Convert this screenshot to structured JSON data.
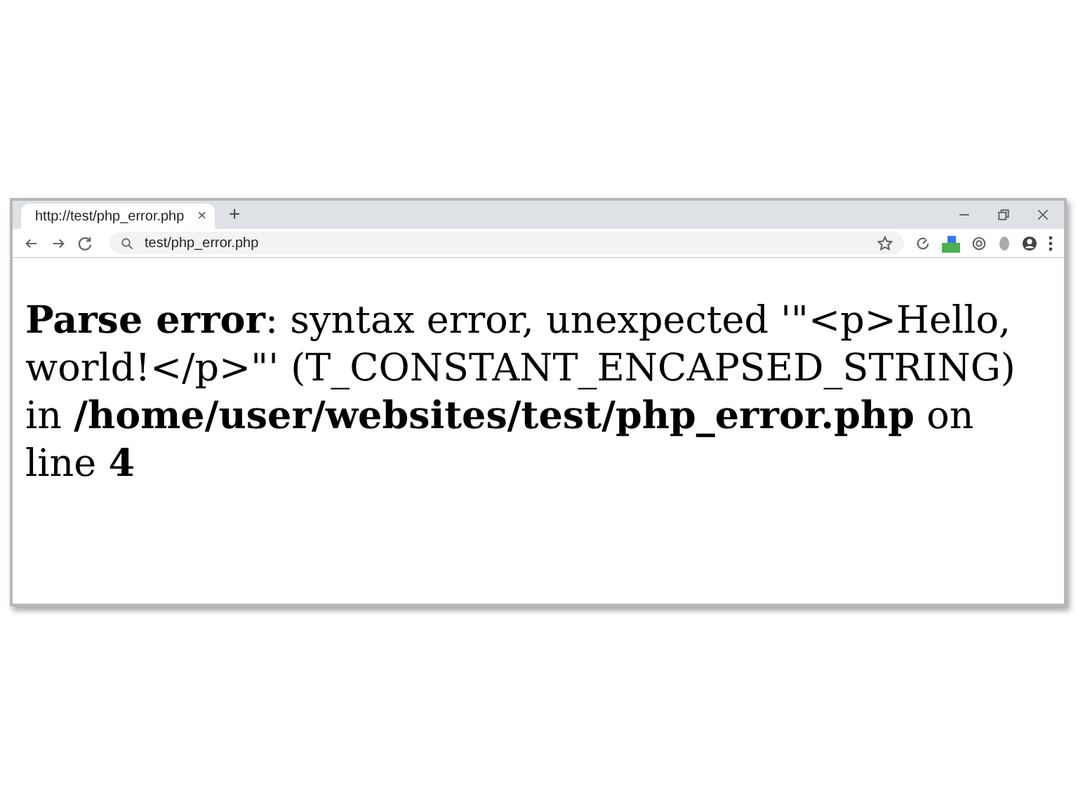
{
  "tab": {
    "title": "http://test/php_error.php",
    "close": "×",
    "new_tab": "+"
  },
  "address_bar": {
    "url": "test/php_error.php"
  },
  "content": {
    "message": "**Parse error**: syntax error, unexpected '\"<p>Hello, world!</p>\"' (T_CONSTANT_ENCAPSED_STRING) in **/home/user/websites/test/php_error.php** on line **4**"
  }
}
